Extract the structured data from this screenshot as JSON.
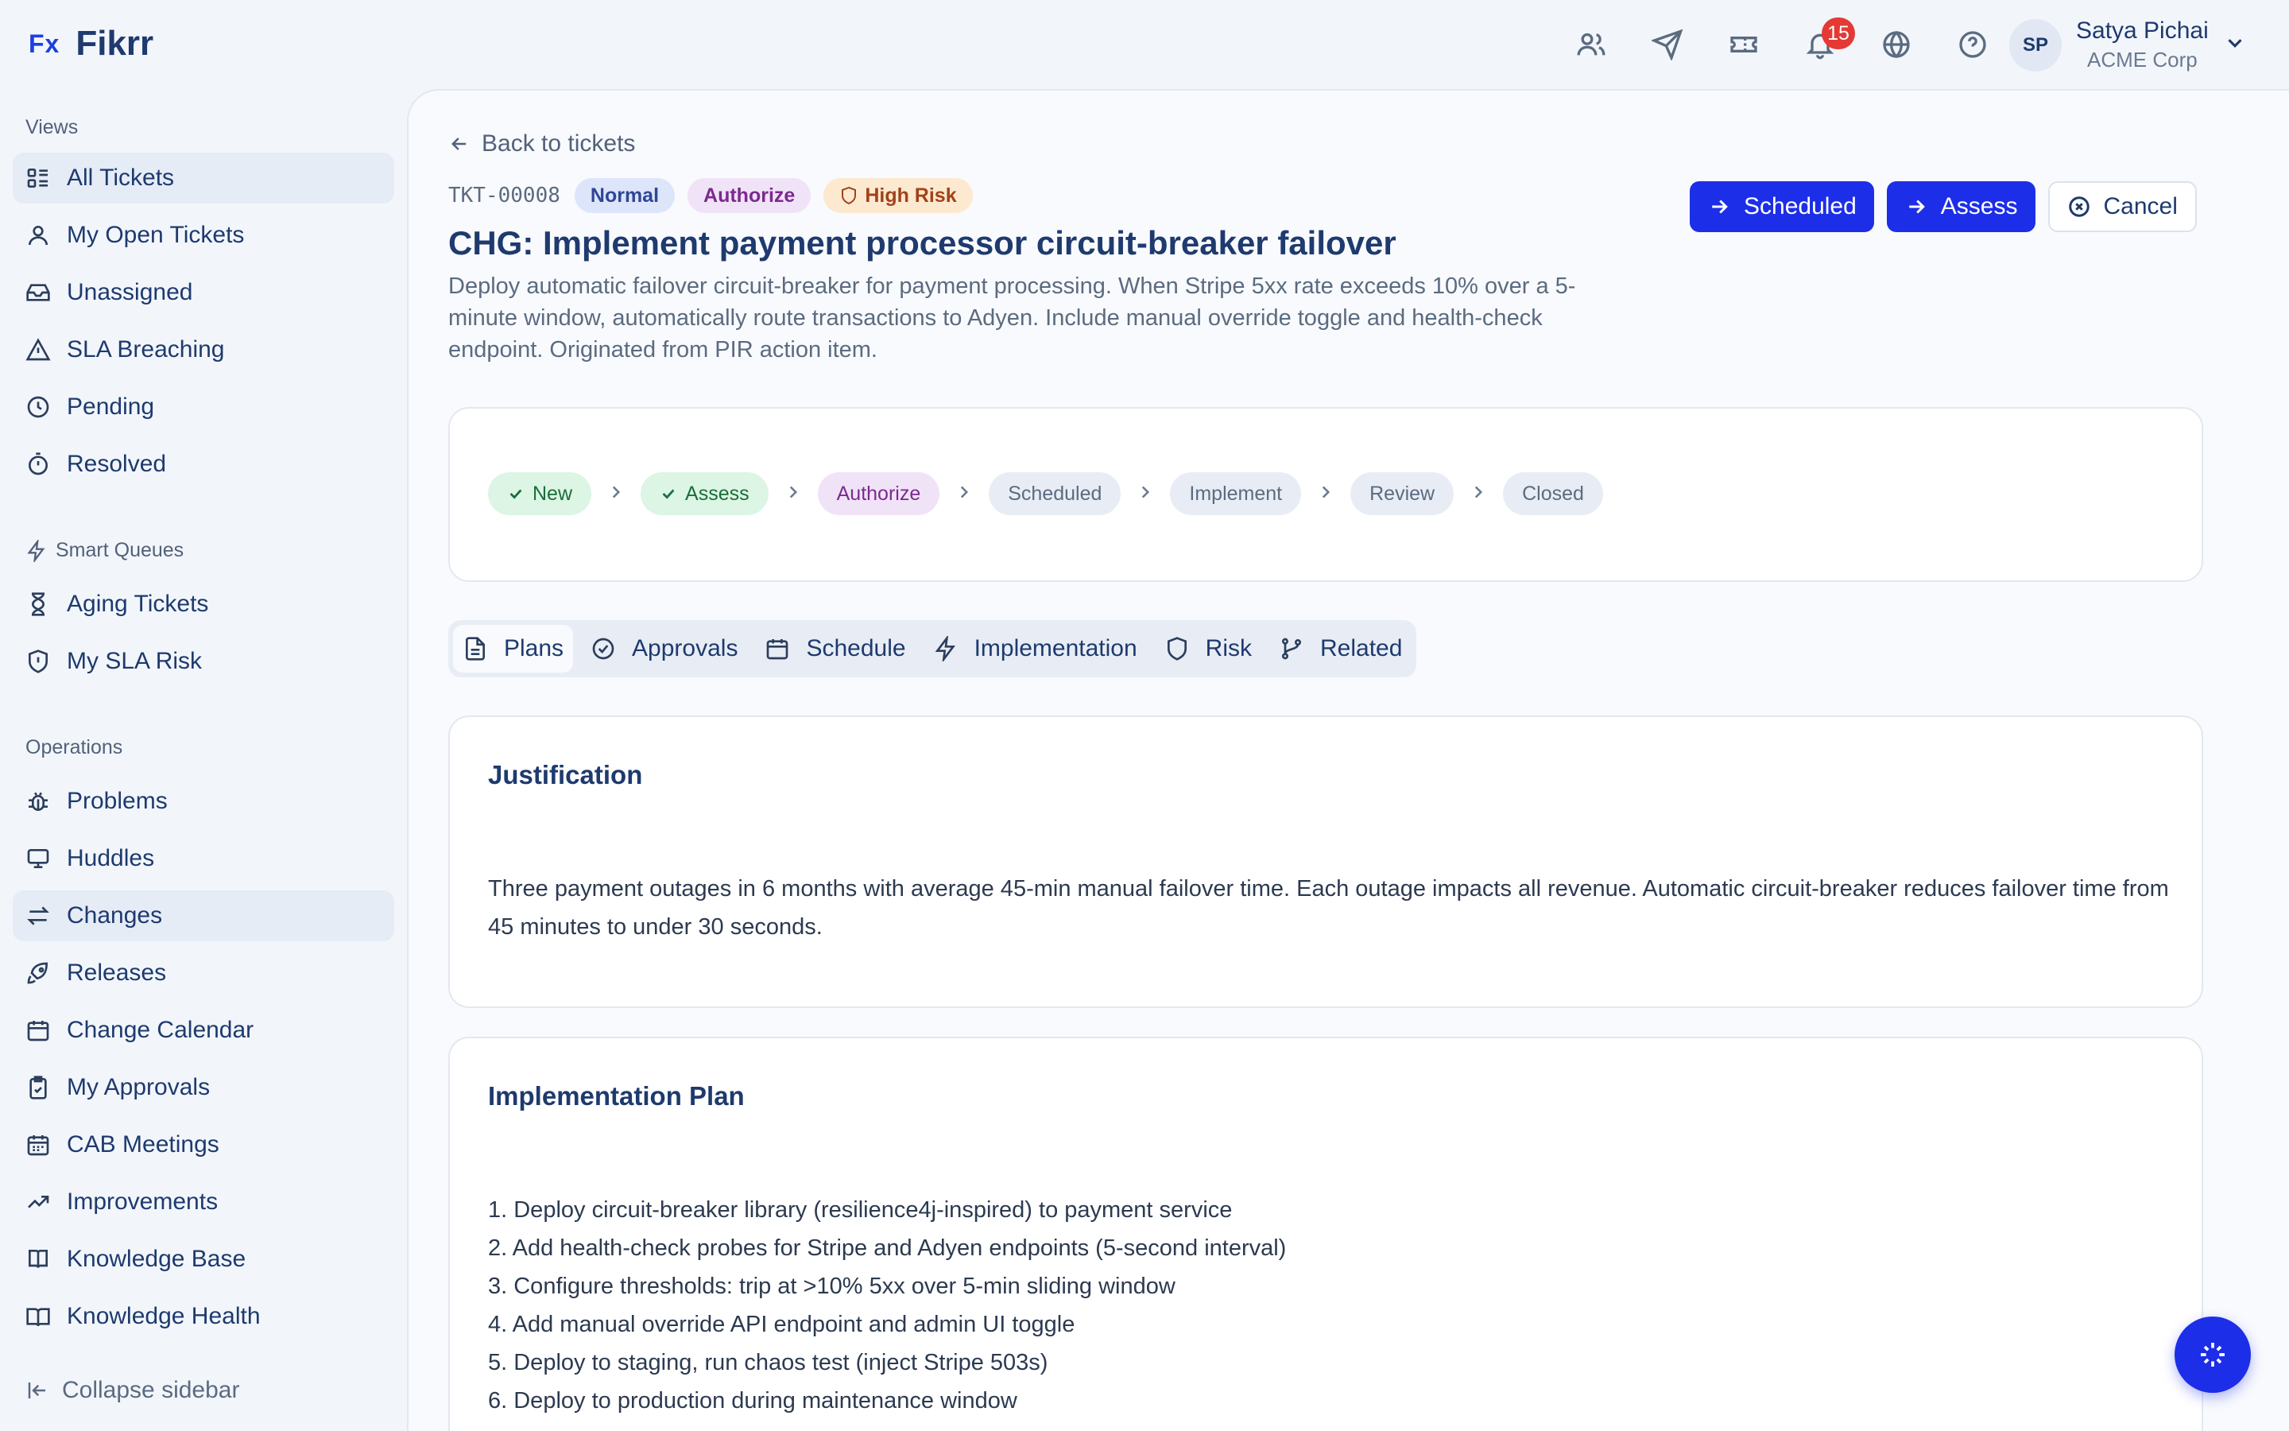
{
  "brand": {
    "mark": "Fx",
    "name": "Fikrr"
  },
  "header": {
    "icons": [
      "users-icon",
      "send-icon",
      "ticket-icon",
      "bell-icon",
      "globe-icon",
      "help-icon"
    ],
    "notification_count": "15",
    "user": {
      "initials": "SP",
      "name": "Satya Pichai",
      "org": "ACME Corp"
    }
  },
  "sidebar": {
    "views_title": "Views",
    "views": [
      {
        "label": "All Tickets",
        "icon": "list-icon",
        "active": true
      },
      {
        "label": "My Open Tickets",
        "icon": "user-icon"
      },
      {
        "label": "Unassigned",
        "icon": "inbox-icon"
      },
      {
        "label": "SLA Breaching",
        "icon": "alert-triangle-icon"
      },
      {
        "label": "Pending",
        "icon": "clock-icon"
      },
      {
        "label": "Resolved",
        "icon": "timer-icon"
      }
    ],
    "smart_title": "Smart Queues",
    "smart": [
      {
        "label": "Aging Tickets",
        "icon": "hourglass-icon"
      },
      {
        "label": "My SLA Risk",
        "icon": "shield-alert-icon"
      }
    ],
    "ops_title": "Operations",
    "ops": [
      {
        "label": "Problems",
        "icon": "bug-icon"
      },
      {
        "label": "Huddles",
        "icon": "monitor-icon"
      },
      {
        "label": "Changes",
        "icon": "swap-icon",
        "active": true
      },
      {
        "label": "Releases",
        "icon": "rocket-icon"
      },
      {
        "label": "Change Calendar",
        "icon": "calendar-icon"
      },
      {
        "label": "My Approvals",
        "icon": "clipboard-check-icon"
      },
      {
        "label": "CAB Meetings",
        "icon": "calendar-grid-icon"
      },
      {
        "label": "Improvements",
        "icon": "trend-up-icon"
      },
      {
        "label": "Knowledge Base",
        "icon": "book-icon"
      },
      {
        "label": "Knowledge Health",
        "icon": "book-open-icon"
      }
    ],
    "collapse_label": "Collapse sidebar"
  },
  "ticket": {
    "back_label": "Back to tickets",
    "id": "TKT-00008",
    "badges": {
      "type": "Normal",
      "state": "Authorize",
      "risk": "High Risk"
    },
    "title": "CHG: Implement payment processor circuit-breaker failover",
    "description": "Deploy automatic failover circuit-breaker for payment processing. When Stripe 5xx rate exceeds 10% over a 5-minute window, automatically route transactions to Adyen. Include manual override toggle and health-check endpoint. Originated from PIR action item.",
    "actions": {
      "scheduled": "Scheduled",
      "assess": "Assess",
      "cancel": "Cancel"
    }
  },
  "workflow": {
    "steps": [
      {
        "label": "New",
        "status": "done"
      },
      {
        "label": "Assess",
        "status": "done"
      },
      {
        "label": "Authorize",
        "status": "current"
      },
      {
        "label": "Scheduled",
        "status": "pending"
      },
      {
        "label": "Implement",
        "status": "pending"
      },
      {
        "label": "Review",
        "status": "pending"
      },
      {
        "label": "Closed",
        "status": "pending"
      }
    ]
  },
  "tabs": [
    {
      "label": "Plans",
      "icon": "file-text-icon",
      "active": true
    },
    {
      "label": "Approvals",
      "icon": "check-circle-icon"
    },
    {
      "label": "Schedule",
      "icon": "calendar-icon"
    },
    {
      "label": "Implementation",
      "icon": "zap-icon"
    },
    {
      "label": "Risk",
      "icon": "shield-icon"
    },
    {
      "label": "Related",
      "icon": "git-branch-icon"
    }
  ],
  "justification": {
    "title": "Justification",
    "body": "Three payment outages in 6 months with average 45-min manual failover time. Each outage impacts all revenue. Automatic circuit-breaker reduces failover time from 45 minutes to under 30 seconds."
  },
  "implementation_plan": {
    "title": "Implementation Plan",
    "steps": [
      "1. Deploy circuit-breaker library (resilience4j-inspired) to payment service",
      "2. Add health-check probes for Stripe and Adyen endpoints (5-second interval)",
      "3. Configure thresholds: trip at >10% 5xx over 5-min sliding window",
      "4. Add manual override API endpoint and admin UI toggle",
      "5. Deploy to staging, run chaos test (inject Stripe 503s)",
      "6. Deploy to production during maintenance window"
    ]
  },
  "colors": {
    "accent": "#1d2ee8",
    "brand": "#1e3a6e",
    "danger": "#e53935"
  }
}
